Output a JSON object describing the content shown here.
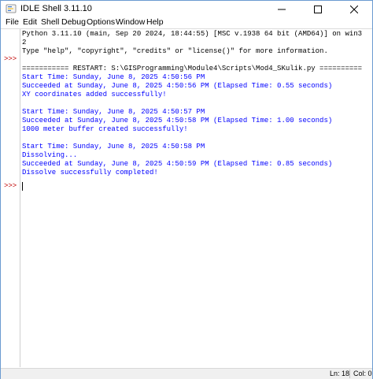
{
  "window": {
    "title": "IDLE Shell 3.11.10"
  },
  "menu": {
    "items": [
      "File",
      "Edit",
      "Shell",
      "Debug",
      "Options",
      "Window",
      "Help"
    ]
  },
  "shell": {
    "prompt": ">>>",
    "lines": [
      {
        "text": "Python 3.11.10 (main, Sep 20 2024, 18:44:55) [MSC v.1938 64 bit (AMD64)] on win3",
        "color": "black"
      },
      {
        "text": "2",
        "color": "black"
      },
      {
        "text": "Type \"help\", \"copyright\", \"credits\" or \"license()\" for more information.",
        "color": "black"
      },
      {
        "text": "",
        "color": "black"
      },
      {
        "text": "=========== RESTART: S:\\GISProgramming\\Module4\\Scripts\\Mod4_SKulik.py ==========",
        "color": "black"
      },
      {
        "text": "Start Time: Sunday, June 8, 2025 4:50:56 PM",
        "color": "blue"
      },
      {
        "text": "Succeeded at Sunday, June 8, 2025 4:50:56 PM (Elapsed Time: 0.55 seconds)",
        "color": "blue"
      },
      {
        "text": "XY coordinates added successfully!",
        "color": "blue"
      },
      {
        "text": "",
        "color": "blue"
      },
      {
        "text": "Start Time: Sunday, June 8, 2025 4:50:57 PM",
        "color": "blue"
      },
      {
        "text": "Succeeded at Sunday, June 8, 2025 4:50:58 PM (Elapsed Time: 1.00 seconds)",
        "color": "blue"
      },
      {
        "text": "1000 meter buffer created successfully!",
        "color": "blue"
      },
      {
        "text": "",
        "color": "blue"
      },
      {
        "text": "Start Time: Sunday, June 8, 2025 4:50:58 PM",
        "color": "blue"
      },
      {
        "text": "Dissolving...",
        "color": "blue"
      },
      {
        "text": "Succeeded at Sunday, June 8, 2025 4:50:59 PM (Elapsed Time: 0.85 seconds)",
        "color": "blue"
      },
      {
        "text": "Dissolve successfully completed!",
        "color": "blue"
      }
    ]
  },
  "status": {
    "ln": "Ln: 18",
    "col": "Col: 0"
  },
  "colors": {
    "black": "#000000",
    "blue": "#0000ff",
    "prompt": "#c00000"
  }
}
